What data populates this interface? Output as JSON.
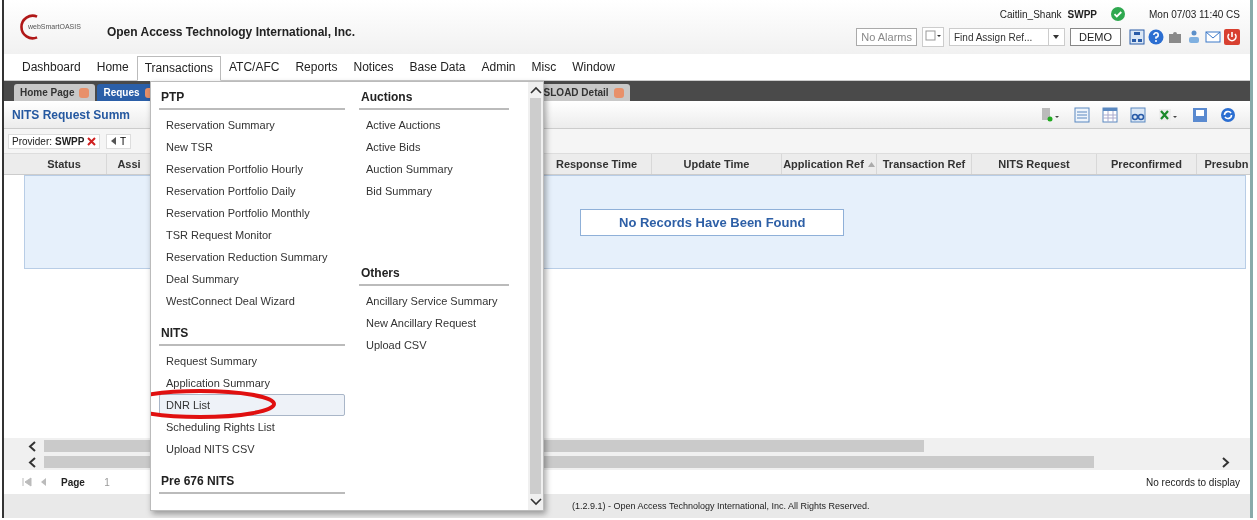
{
  "header": {
    "logo_text": "webSmartOASIS",
    "company": "Open Access Technology International, Inc.",
    "user": "Caitlin_Shank",
    "provider": "SWPP",
    "datetime": "Mon 07/03 11:40 CS",
    "alarms": "No Alarms",
    "find_placeholder": "Find Assign Ref...",
    "environment": "DEMO"
  },
  "menu_bar": [
    {
      "label": "Dashboard",
      "selected": false
    },
    {
      "label": "Home",
      "selected": false
    },
    {
      "label": "Transactions",
      "selected": true
    },
    {
      "label": "ATC/AFC",
      "selected": false
    },
    {
      "label": "Reports",
      "selected": false
    },
    {
      "label": "Notices",
      "selected": false
    },
    {
      "label": "Base Data",
      "selected": false
    },
    {
      "label": "Admin",
      "selected": false
    },
    {
      "label": "Misc",
      "selected": false
    },
    {
      "label": "Window",
      "selected": false
    }
  ],
  "page_tabs": [
    {
      "label": "Home Page",
      "selected": false
    },
    {
      "label": "Reques",
      "selected": true
    },
    {
      "label": "SLOAD Detail",
      "selected": false
    }
  ],
  "panel": {
    "title": "NITS Request Summ",
    "filter_label": "Provider:",
    "filter_value": "SWPP",
    "filter_2": "T",
    "columns": [
      {
        "label": "Status",
        "sorted": false
      },
      {
        "label": "Assi",
        "sorted": false
      },
      {
        "label": "Response Time",
        "sorted": false
      },
      {
        "label": "Update Time",
        "sorted": false
      },
      {
        "label": "Application Ref",
        "sorted": true
      },
      {
        "label": "Transaction Ref",
        "sorted": false
      },
      {
        "label": "NITS Request",
        "sorted": false
      },
      {
        "label": "Preconfirmed",
        "sorted": false
      },
      {
        "label": "Presubn",
        "sorted": false
      }
    ],
    "empty_message": "No Records Have Been Found"
  },
  "pager": {
    "label": "Page",
    "page": "1",
    "status": "No records to display"
  },
  "footer": "(1.2.9.1) - Open Access Technology International, Inc. All Rights Reserved.",
  "dropdown": {
    "columns": [
      [
        {
          "title": "PTP",
          "items": [
            {
              "label": "Reservation Summary",
              "selected": false,
              "circled": false
            },
            {
              "label": "New TSR",
              "selected": false,
              "circled": false
            },
            {
              "label": "Reservation Portfolio Hourly",
              "selected": false,
              "circled": false
            },
            {
              "label": "Reservation Portfolio Daily",
              "selected": false,
              "circled": false
            },
            {
              "label": "Reservation Portfolio Monthly",
              "selected": false,
              "circled": false
            },
            {
              "label": "TSR Request Monitor",
              "selected": false,
              "circled": false
            },
            {
              "label": "Reservation Reduction Summary",
              "selected": false,
              "circled": false
            },
            {
              "label": "Deal Summary",
              "selected": false,
              "circled": false
            },
            {
              "label": "WestConnect Deal Wizard",
              "selected": false,
              "circled": false
            }
          ]
        },
        {
          "title": "NITS",
          "items": [
            {
              "label": "Request Summary",
              "selected": false,
              "circled": false
            },
            {
              "label": "Application Summary",
              "selected": false,
              "circled": false
            },
            {
              "label": "DNR List",
              "selected": true,
              "circled": true
            },
            {
              "label": "Scheduling Rights List",
              "selected": false,
              "circled": false
            },
            {
              "label": "Upload NITS CSV",
              "selected": false,
              "circled": false
            }
          ]
        },
        {
          "title": "Pre 676 NITS"
        }
      ],
      [
        {
          "title": "Auctions",
          "items": [
            {
              "label": "Active Auctions",
              "selected": false,
              "circled": false
            },
            {
              "label": "Active Bids",
              "selected": false,
              "circled": false
            },
            {
              "label": "Auction Summary",
              "selected": false,
              "circled": false
            },
            {
              "label": "Bid Summary",
              "selected": false,
              "circled": false
            }
          ]
        },
        {
          "title": "Others",
          "items": [
            {
              "label": "Ancillary Service Summary",
              "selected": false,
              "circled": false
            },
            {
              "label": "New Ancillary Request",
              "selected": false,
              "circled": false
            },
            {
              "label": "Upload CSV",
              "selected": false,
              "circled": false
            }
          ]
        }
      ]
    ]
  }
}
